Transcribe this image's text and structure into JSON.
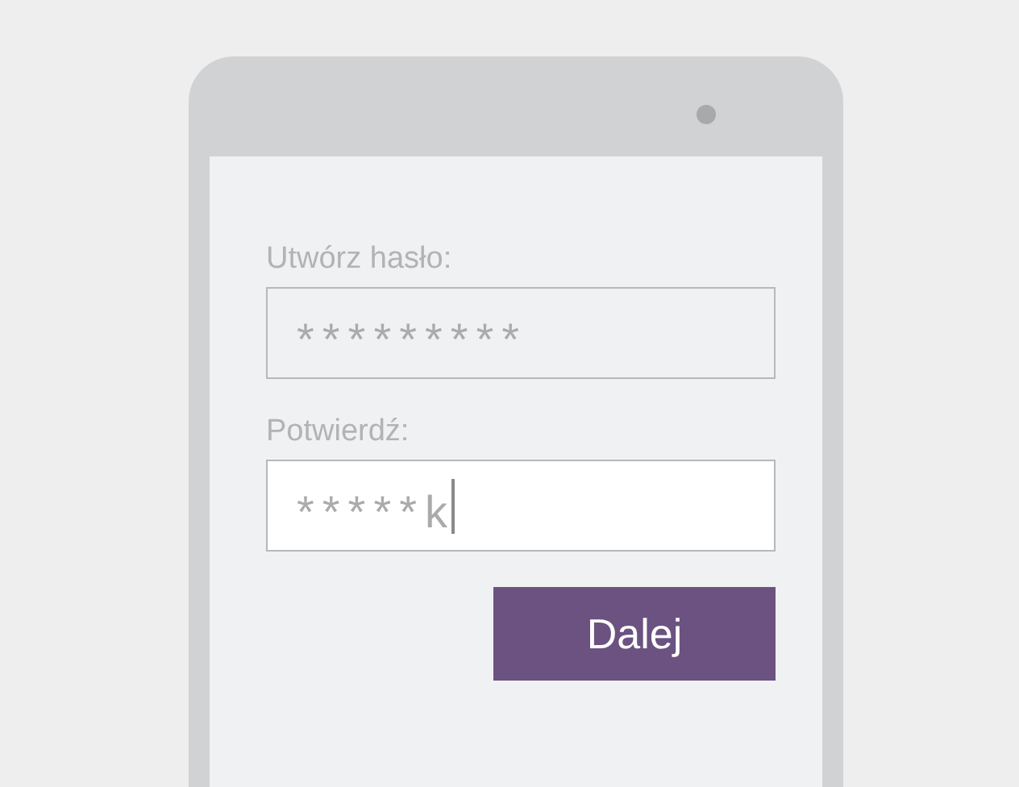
{
  "form": {
    "fields": [
      {
        "label": "Utwórz hasło:",
        "value": "*********",
        "focused": false
      },
      {
        "label": "Potwierdź:",
        "value": "*****k",
        "focused": true
      }
    ],
    "button": "Dalej"
  }
}
